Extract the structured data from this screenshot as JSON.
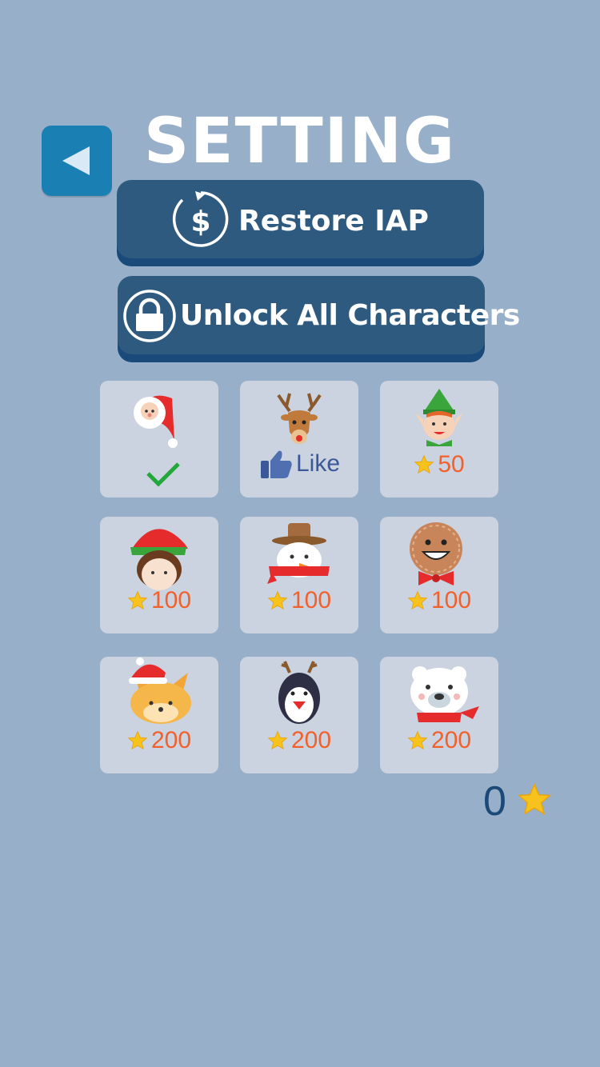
{
  "title": "SETTING",
  "buttons": {
    "restore_label": "Restore IAP",
    "unlock_label": "Unlock All Characters"
  },
  "colors": {
    "background": "#97afc8",
    "button_navy": "#2e5a80",
    "back_button": "#1a7fb3",
    "tile": "#cad3df",
    "price": "#f2602b",
    "like": "#3b5998"
  },
  "characters": [
    {
      "name": "santa",
      "status": "selected"
    },
    {
      "name": "reindeer",
      "unlock": "like",
      "label": "Like"
    },
    {
      "name": "elf-boy",
      "price": "50"
    },
    {
      "name": "elf-girl",
      "price": "100"
    },
    {
      "name": "snowman",
      "price": "100"
    },
    {
      "name": "gingerbread",
      "price": "100"
    },
    {
      "name": "fox",
      "price": "200"
    },
    {
      "name": "penguin",
      "price": "200"
    },
    {
      "name": "polar-bear",
      "price": "200"
    }
  ],
  "star_balance": "0"
}
